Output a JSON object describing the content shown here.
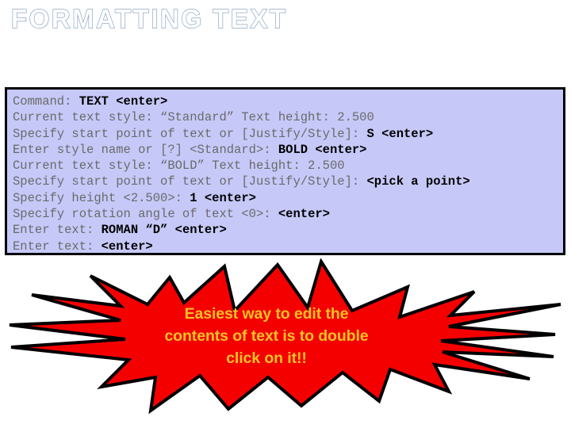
{
  "slide": {
    "title": "FORMATTING TEXT",
    "background_color": "#ffffff",
    "title_outline_color": "#7b95b5",
    "title_fill_color": "#ffffff"
  },
  "command_box": {
    "background_color": "#c6c9f8",
    "border_color": "#000000",
    "prompt_color": "#6a6a6a",
    "input_color": "#000000",
    "lines": [
      {
        "prompt": "Command: ",
        "input": "TEXT <enter>"
      },
      {
        "prompt": "Current text style: “Standard” Text height: 2.500",
        "input": ""
      },
      {
        "prompt": "Specify start point of text or [Justify/Style]: ",
        "input": "S <enter>"
      },
      {
        "prompt": "Enter style name or [?] <Standard>: ",
        "input": "BOLD <enter>"
      },
      {
        "prompt": "Current text style: “BOLD” Text height: 2.500",
        "input": ""
      },
      {
        "prompt": "Specify start point of text or [Justify/Style]: ",
        "input": "<pick a point>"
      },
      {
        "prompt": "Specify height <2.500>: ",
        "input": "1 <enter>"
      },
      {
        "prompt": "Specify rotation angle of text <0>: ",
        "input": "<enter>"
      },
      {
        "prompt": "Enter text: ",
        "input": "ROMAN “D” <enter>"
      },
      {
        "prompt": "Enter text: ",
        "input": "<enter>"
      }
    ]
  },
  "callout": {
    "shape": "explosion-starburst",
    "fill_color": "#f50000",
    "outline_color": "#000000",
    "text_color": "#f5c324",
    "lines": [
      "Easiest way to edit the",
      "contents of text is to double",
      "click on it!!"
    ]
  }
}
